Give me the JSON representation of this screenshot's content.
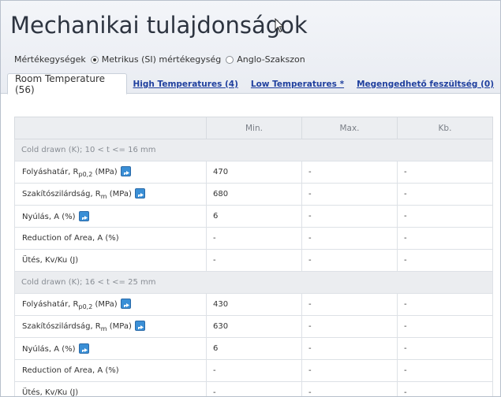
{
  "title": "Mechanikai tulajdonságok",
  "units": {
    "label": "Mértékegységek",
    "options": [
      "Metrikus (SI) mértékegység",
      "Anglo-Szakszon"
    ],
    "selected": 0
  },
  "tabs": {
    "active": "Room Temperature (56)",
    "links": [
      "High Temperatures (4)",
      "Low Temperatures *",
      "Megengedhető feszültség (0)"
    ]
  },
  "table": {
    "headers": [
      "",
      "Min.",
      "Max.",
      "Kb."
    ],
    "groups": [
      {
        "label": "Cold drawn (K); 10 < t <= 16 mm",
        "rows": [
          {
            "name": "Folyáshatár, R",
            "sub": "p0,2",
            "unit": " (MPa)",
            "info": true,
            "min": "470",
            "max": "-",
            "kb": "-"
          },
          {
            "name": "Szakítószilárdság, R",
            "sub": "m",
            "unit": " (MPa)",
            "info": true,
            "min": "680",
            "max": "-",
            "kb": "-"
          },
          {
            "name": "Nyúlás, A (%)",
            "sub": "",
            "unit": "",
            "info": true,
            "min": "6",
            "max": "-",
            "kb": "-"
          },
          {
            "name": "Reduction of Area, A (%)",
            "sub": "",
            "unit": "",
            "info": false,
            "min": "-",
            "max": "-",
            "kb": "-"
          },
          {
            "name": "Ütés, Kv/Ku (J)",
            "sub": "",
            "unit": "",
            "info": false,
            "min": "-",
            "max": "-",
            "kb": "-"
          }
        ]
      },
      {
        "label": "Cold drawn (K); 16 < t <= 25 mm",
        "rows": [
          {
            "name": "Folyáshatár, R",
            "sub": "p0,2",
            "unit": " (MPa)",
            "info": true,
            "min": "430",
            "max": "-",
            "kb": "-"
          },
          {
            "name": "Szakítószilárdság, R",
            "sub": "m",
            "unit": " (MPa)",
            "info": true,
            "min": "630",
            "max": "-",
            "kb": "-"
          },
          {
            "name": "Nyúlás, A (%)",
            "sub": "",
            "unit": "",
            "info": true,
            "min": "6",
            "max": "-",
            "kb": "-"
          },
          {
            "name": "Reduction of Area, A (%)",
            "sub": "",
            "unit": "",
            "info": false,
            "min": "-",
            "max": "-",
            "kb": "-"
          },
          {
            "name": "Ütés, Kv/Ku (J)",
            "sub": "",
            "unit": "",
            "info": false,
            "min": "-",
            "max": "-",
            "kb": "-"
          }
        ]
      }
    ]
  }
}
